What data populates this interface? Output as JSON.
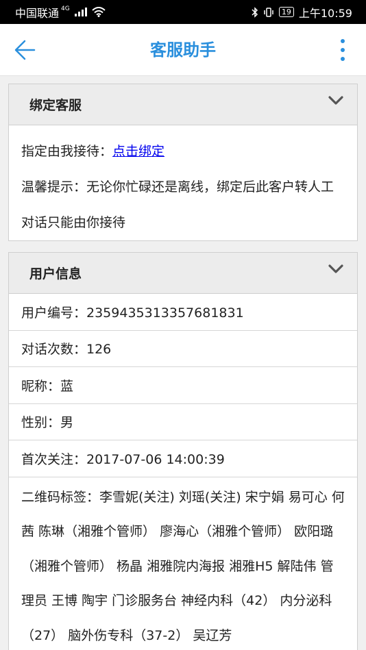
{
  "statusbar": {
    "carrier": "中国联通",
    "network": "4G",
    "battery": "19",
    "time": "上午10:59"
  },
  "header": {
    "title": "客服助手",
    "back_icon": "arrow-left-icon",
    "menu_icon": "more-vertical-icon",
    "accent_color": "#2a8fdd"
  },
  "bind_panel": {
    "title": "绑定客服",
    "assign_label": "指定由我接待：",
    "assign_link": "点击绑定",
    "tip_text": "温馨提示：无论你忙碌还是离线，绑定后此客户转人工对话只能由你接待"
  },
  "user_panel": {
    "title": "用户信息",
    "user_id": "用户编号：2359435313357681831",
    "chat_count": "对话次数：126",
    "nickname": "昵称：蓝",
    "gender": "性别：男",
    "first_follow": "首次关注：2017-07-06 14:00:39",
    "qr_tags": "二维码标签：李雪妮(关注) 刘瑶(关注) 宋宁娟 易可心 何茜 陈琳（湘雅个管师） 廖海心（湘雅个管师） 欧阳璐（湘雅个管师） 杨晶 湘雅院内海报 湘雅H5 解陆伟 管理员 王博 陶宇 门诊服务台 神经内科（42） 内分泌科（27） 脑外伤专科（37-2） 吴辽芳"
  }
}
